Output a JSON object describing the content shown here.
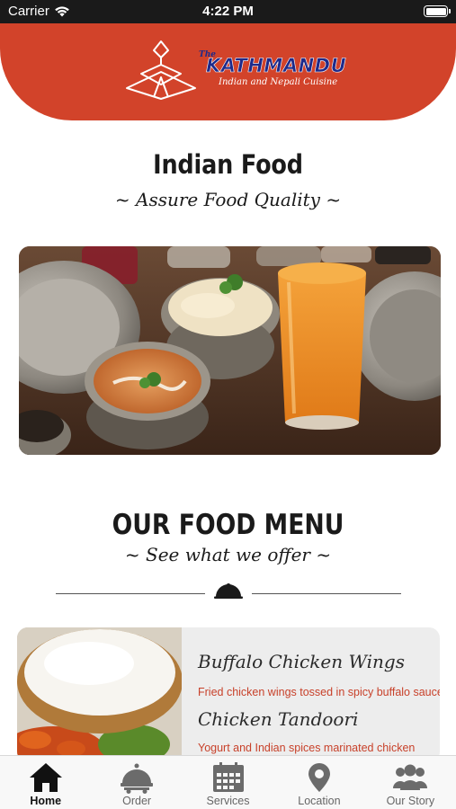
{
  "status_bar": {
    "carrier": "Carrier",
    "time": "4:22 PM"
  },
  "header": {
    "logo_the": "The",
    "logo_name": "KATHMANDU",
    "logo_sub": "Indian and Nepali Cuisine"
  },
  "intro": {
    "title": "Indian Food",
    "subtitle": "~ Assure Food Quality ~"
  },
  "menu_section": {
    "title": "OUR FOOD MENU",
    "subtitle": "~ See what we offer ~"
  },
  "menu_items": [
    {
      "name": "Buffalo Chicken Wings",
      "description": "Fried chicken wings tossed in spicy buffalo sauce."
    },
    {
      "name": "Chicken Tandoori",
      "description": "Yogurt and Indian spices marinated chicken"
    }
  ],
  "tabs": [
    {
      "label": "Home",
      "icon": "home-icon",
      "active": true
    },
    {
      "label": "Order",
      "icon": "order-cart-icon",
      "active": false
    },
    {
      "label": "Services",
      "icon": "calendar-icon",
      "active": false
    },
    {
      "label": "Location",
      "icon": "location-pin-icon",
      "active": false
    },
    {
      "label": "Our Story",
      "icon": "group-icon",
      "active": false
    }
  ],
  "colors": {
    "brand_red": "#d2432a",
    "logo_blue": "#1e2a8a",
    "description_red": "#c8412a"
  }
}
